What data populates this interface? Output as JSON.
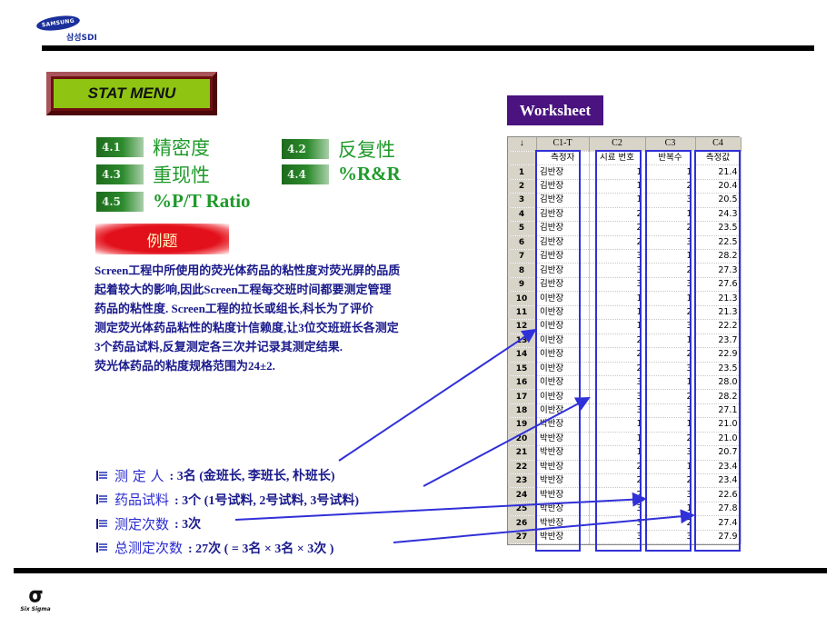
{
  "header": {
    "logo_brand": "SAMSUNG",
    "logo_sub": "삼성SDI"
  },
  "stat_menu": {
    "label": "STAT MENU"
  },
  "menu": [
    {
      "num": "4.1",
      "label": "精密度"
    },
    {
      "num": "4.2",
      "label": "反复性"
    },
    {
      "num": "4.3",
      "label": "重现性"
    },
    {
      "num": "4.4",
      "label": "%R&R"
    },
    {
      "num": "4.5",
      "label": "%P/T Ratio"
    }
  ],
  "example": {
    "tag": "例题",
    "lines": [
      "Screen工程中所使用的荧光体药品的粘性度对荧光屏的品质",
      "起着较大的影响,因此Screen工程每交班时间都要测定管理",
      "药品的粘性度. Screen工程的拉长或组长,科长为了评价",
      "测定荧光体药品粘性的粘度计信赖度,让3位交班班长各测定",
      "3个药品试料,反复测定各三次并记录其测定结果.",
      "荧光体药品的粘度规格范围为24±2."
    ]
  },
  "bullets": [
    {
      "key": "测 定 人",
      "value": ": 3名 (金班长, 李班长, 朴班长)"
    },
    {
      "key": "药品试料",
      "value": ": 3个 (1号试料, 2号试料, 3号试料)"
    },
    {
      "key": "测定次数",
      "value": ": 3次"
    },
    {
      "key": "总测定次数",
      "value": ": 27次 ( = 3名 × 3名 × 3次 )"
    }
  ],
  "worksheet": {
    "tag": "Worksheet",
    "corner": "↓",
    "col_ids": [
      "C1-T",
      "C2",
      "C3",
      "C4"
    ],
    "col_names": [
      "측정자",
      "시료 번호",
      "반복수",
      "측정값"
    ],
    "rows": [
      [
        "1",
        "김반장",
        "1",
        "1",
        "21.4"
      ],
      [
        "2",
        "김반장",
        "1",
        "2",
        "20.4"
      ],
      [
        "3",
        "김반장",
        "1",
        "3",
        "20.5"
      ],
      [
        "4",
        "김반장",
        "2",
        "1",
        "24.3"
      ],
      [
        "5",
        "김반장",
        "2",
        "2",
        "23.5"
      ],
      [
        "6",
        "김반장",
        "2",
        "3",
        "22.5"
      ],
      [
        "7",
        "김반장",
        "3",
        "1",
        "28.2"
      ],
      [
        "8",
        "김반장",
        "3",
        "2",
        "27.3"
      ],
      [
        "9",
        "김반장",
        "3",
        "3",
        "27.6"
      ],
      [
        "10",
        "이반장",
        "1",
        "1",
        "21.3"
      ],
      [
        "11",
        "이반장",
        "1",
        "2",
        "21.3"
      ],
      [
        "12",
        "이반장",
        "1",
        "3",
        "22.2"
      ],
      [
        "13",
        "이반장",
        "2",
        "1",
        "23.7"
      ],
      [
        "14",
        "이반장",
        "2",
        "2",
        "22.9"
      ],
      [
        "15",
        "이반장",
        "2",
        "3",
        "23.5"
      ],
      [
        "16",
        "이반장",
        "3",
        "1",
        "28.0"
      ],
      [
        "17",
        "이반장",
        "3",
        "2",
        "28.2"
      ],
      [
        "18",
        "이반장",
        "3",
        "3",
        "27.1"
      ],
      [
        "19",
        "박반장",
        "1",
        "1",
        "21.0"
      ],
      [
        "20",
        "박반장",
        "1",
        "2",
        "21.0"
      ],
      [
        "21",
        "박반장",
        "1",
        "3",
        "20.7"
      ],
      [
        "22",
        "박반장",
        "2",
        "1",
        "23.4"
      ],
      [
        "23",
        "박반장",
        "2",
        "2",
        "23.4"
      ],
      [
        "24",
        "박반장",
        "2",
        "3",
        "22.6"
      ],
      [
        "25",
        "박반장",
        "3",
        "1",
        "27.8"
      ],
      [
        "26",
        "박반장",
        "3",
        "2",
        "27.4"
      ],
      [
        "27",
        "박반장",
        "3",
        "3",
        "27.9"
      ]
    ]
  },
  "footer": {
    "logo_text": "Six Sigma"
  },
  "colors": {
    "menu_green": "#1f9a2a",
    "text_navy": "#1a1a8c",
    "arrow_blue": "#3030d8",
    "worksheet_purple": "#4a1380",
    "stat_menu_green": "#8fc413",
    "example_red": "#e2101a"
  }
}
